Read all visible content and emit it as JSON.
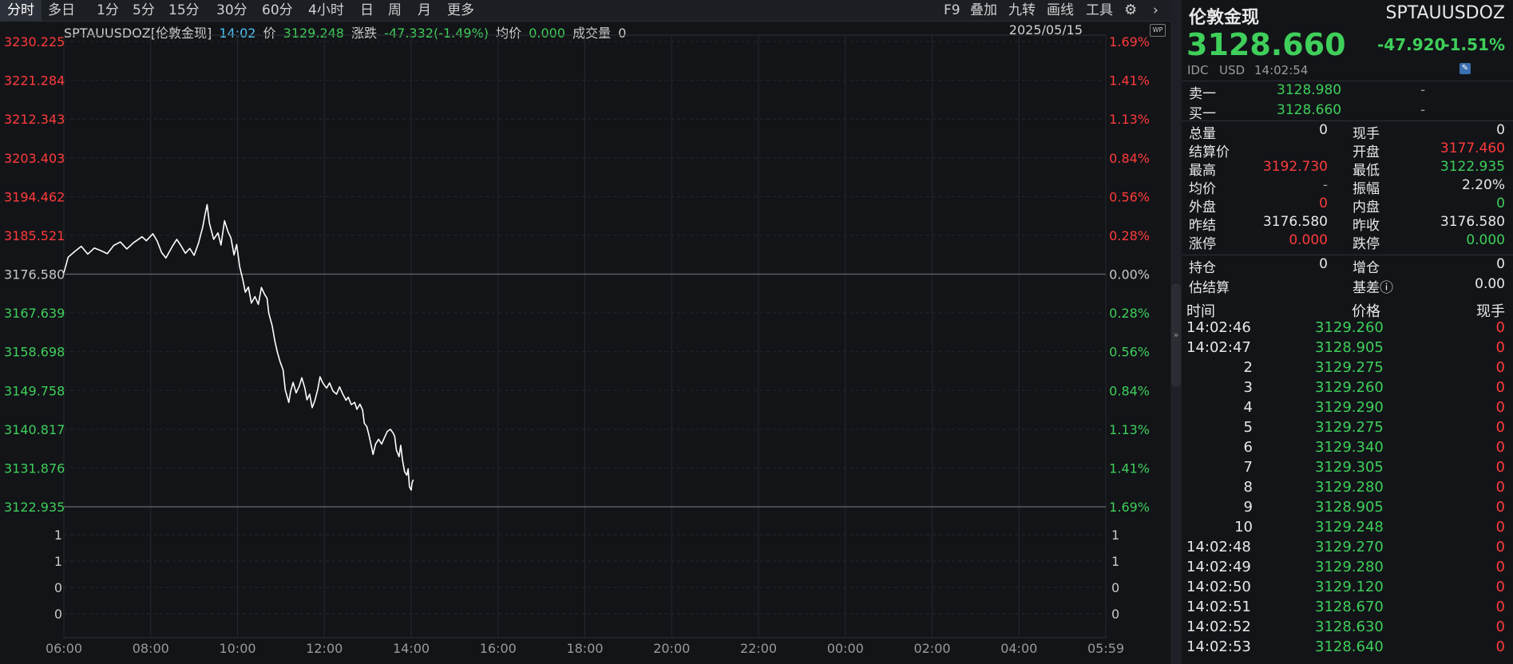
{
  "toolbar": {
    "tabs": [
      "分时",
      "多日",
      "1分",
      "5分",
      "15分",
      "30分",
      "60分",
      "4小时",
      "日",
      "周",
      "月",
      "更多"
    ],
    "active_tab": "分时",
    "right_items": [
      "F9",
      "叠加",
      "九转",
      "画线",
      "工具"
    ],
    "gear_icon": "gear-icon",
    "more_icon": "chevron-right-icon"
  },
  "info": {
    "symbol": "SPTAUUSDOZ[伦敦金现]",
    "time": "14:02",
    "price_label": "价",
    "price": "3129.248",
    "change_label": "涨跌",
    "change": "-47.332(-1.49%)",
    "avg_label": "均价",
    "avg": "0.000",
    "volume_label": "成交量",
    "volume": "0",
    "date": "2025/05/15",
    "badge": "WP"
  },
  "chart_data": {
    "type": "line",
    "title": "",
    "price_axis": {
      "ticks": [
        "3230.225",
        "3221.284",
        "3212.343",
        "3203.403",
        "3194.462",
        "3185.521",
        "3176.580",
        "3167.639",
        "3158.698",
        "3149.758",
        "3140.817",
        "3131.876",
        "3122.935"
      ],
      "pct_ticks": [
        "1.69%",
        "1.41%",
        "1.13%",
        "0.84%",
        "0.56%",
        "0.28%",
        "0.00%",
        "0.28%",
        "0.56%",
        "0.84%",
        "1.13%",
        "1.41%",
        "1.69%"
      ],
      "ylim": [
        3122.935,
        3230.225
      ],
      "baseline": 3176.58
    },
    "volume_axis": {
      "ticks": [
        "1",
        "1",
        "0",
        "0"
      ]
    },
    "x_ticks": [
      "06:00",
      "08:00",
      "10:00",
      "12:00",
      "14:00",
      "16:00",
      "18:00",
      "20:00",
      "22:00",
      "00:00",
      "02:00",
      "04:00",
      "05:59"
    ],
    "x_unit": "hours_since_06:00",
    "x_range": [
      0,
      24
    ],
    "series": [
      {
        "color": "#ffffff",
        "points": [
          [
            0.0,
            3176.9
          ],
          [
            0.1,
            3180.5
          ],
          [
            0.25,
            3181.8
          ],
          [
            0.4,
            3183.0
          ],
          [
            0.55,
            3181.2
          ],
          [
            0.7,
            3182.6
          ],
          [
            0.85,
            3182.0
          ],
          [
            1.0,
            3181.3
          ],
          [
            1.15,
            3183.2
          ],
          [
            1.3,
            3184.0
          ],
          [
            1.45,
            3182.4
          ],
          [
            1.6,
            3183.8
          ],
          [
            1.8,
            3185.2
          ],
          [
            1.9,
            3184.3
          ],
          [
            2.05,
            3185.9
          ],
          [
            2.15,
            3184.2
          ],
          [
            2.25,
            3181.6
          ],
          [
            2.35,
            3180.3
          ],
          [
            2.5,
            3183.0
          ],
          [
            2.6,
            3184.6
          ],
          [
            2.7,
            3183.1
          ],
          [
            2.8,
            3181.4
          ],
          [
            2.9,
            3182.5
          ],
          [
            3.0,
            3180.9
          ],
          [
            3.1,
            3183.7
          ],
          [
            3.2,
            3187.5
          ],
          [
            3.25,
            3190.2
          ],
          [
            3.3,
            3192.6
          ],
          [
            3.35,
            3188.4
          ],
          [
            3.45,
            3184.6
          ],
          [
            3.55,
            3186.1
          ],
          [
            3.62,
            3183.3
          ],
          [
            3.7,
            3188.9
          ],
          [
            3.78,
            3186.4
          ],
          [
            3.85,
            3184.9
          ],
          [
            3.92,
            3181.0
          ],
          [
            3.98,
            3183.4
          ],
          [
            4.05,
            3178.3
          ],
          [
            4.12,
            3175.4
          ],
          [
            4.18,
            3172.4
          ],
          [
            4.25,
            3173.6
          ],
          [
            4.32,
            3169.9
          ],
          [
            4.4,
            3171.4
          ],
          [
            4.48,
            3169.6
          ],
          [
            4.55,
            3173.5
          ],
          [
            4.62,
            3172.0
          ],
          [
            4.68,
            3171.0
          ],
          [
            4.72,
            3167.6
          ],
          [
            4.8,
            3164.6
          ],
          [
            4.86,
            3161.1
          ],
          [
            4.92,
            3158.5
          ],
          [
            4.98,
            3156.4
          ],
          [
            5.05,
            3154.5
          ],
          [
            5.1,
            3149.9
          ],
          [
            5.18,
            3147.0
          ],
          [
            5.22,
            3149.4
          ],
          [
            5.28,
            3151.6
          ],
          [
            5.35,
            3149.2
          ],
          [
            5.42,
            3150.7
          ],
          [
            5.48,
            3152.7
          ],
          [
            5.55,
            3150.3
          ],
          [
            5.6,
            3147.6
          ],
          [
            5.66,
            3148.9
          ],
          [
            5.72,
            3145.8
          ],
          [
            5.78,
            3147.4
          ],
          [
            5.85,
            3150.1
          ],
          [
            5.9,
            3152.9
          ],
          [
            5.97,
            3151.4
          ],
          [
            6.05,
            3150.3
          ],
          [
            6.12,
            3151.5
          ],
          [
            6.2,
            3149.6
          ],
          [
            6.28,
            3148.9
          ],
          [
            6.35,
            3150.6
          ],
          [
            6.42,
            3149.0
          ],
          [
            6.5,
            3147.5
          ],
          [
            6.55,
            3148.2
          ],
          [
            6.62,
            3146.5
          ],
          [
            6.7,
            3147.0
          ],
          [
            6.75,
            3145.4
          ],
          [
            6.82,
            3146.6
          ],
          [
            6.88,
            3145.3
          ],
          [
            6.92,
            3142.2
          ],
          [
            6.98,
            3141.4
          ],
          [
            7.03,
            3139.3
          ],
          [
            7.08,
            3137.0
          ],
          [
            7.12,
            3135.0
          ],
          [
            7.18,
            3137.4
          ],
          [
            7.25,
            3138.5
          ],
          [
            7.32,
            3137.4
          ],
          [
            7.38,
            3138.8
          ],
          [
            7.45,
            3140.3
          ],
          [
            7.52,
            3140.8
          ],
          [
            7.58,
            3140.0
          ],
          [
            7.62,
            3139.2
          ],
          [
            7.66,
            3136.0
          ],
          [
            7.72,
            3134.5
          ],
          [
            7.76,
            3137.1
          ],
          [
            7.8,
            3133.7
          ],
          [
            7.85,
            3131.0
          ],
          [
            7.9,
            3130.2
          ],
          [
            7.93,
            3131.7
          ],
          [
            7.96,
            3127.6
          ],
          [
            8.0,
            3126.8
          ],
          [
            8.02,
            3128.5
          ],
          [
            8.05,
            3129.2
          ]
        ]
      }
    ]
  },
  "right": {
    "name": "伦敦金现",
    "code": "SPTAUUSDOZ",
    "price": "3128.660",
    "change": "-47.920",
    "change_pct": "-1.51%",
    "source": "IDC",
    "currency": "USD",
    "time": "14:02:54",
    "edit_icon": "pencil-icon",
    "ask_label": "卖一",
    "ask": "3128.980",
    "ask_vol": "-",
    "bid_label": "买一",
    "bid": "3128.660",
    "bid_vol": "-",
    "stats": [
      {
        "l1": "总量",
        "v1": "0",
        "c1": "white",
        "l2": "现手",
        "v2": "0",
        "c2": "white"
      },
      {
        "l1": "结算价",
        "v1": "",
        "c1": "white",
        "l2": "开盘",
        "v2": "3177.460",
        "c2": "red"
      },
      {
        "l1": "最高",
        "v1": "3192.730",
        "c1": "red",
        "l2": "最低",
        "v2": "3122.935",
        "c2": "green"
      },
      {
        "l1": "均价",
        "v1": "-",
        "c1": "grey",
        "l2": "振幅",
        "v2": "2.20%",
        "c2": "white"
      },
      {
        "l1": "外盘",
        "v1": "0",
        "c1": "red",
        "l2": "内盘",
        "v2": "0",
        "c2": "green"
      },
      {
        "l1": "昨结",
        "v1": "3176.580",
        "c1": "white",
        "l2": "昨收",
        "v2": "3176.580",
        "c2": "white"
      },
      {
        "l1": "涨停",
        "v1": "0.000",
        "c1": "red",
        "l2": "跌停",
        "v2": "0.000",
        "c2": "green"
      }
    ],
    "pos_label": "持仓",
    "pos": "0",
    "inc_label": "增仓",
    "inc": "0",
    "est_label": "估结算",
    "basis_label": "基差ⓘ",
    "basis": "0.00",
    "ticks_header": {
      "time": "时间",
      "price": "价格",
      "vol": "现手"
    },
    "ticks": [
      {
        "t": "14:02:46",
        "p": "3129.260",
        "v": "0",
        "indent": false
      },
      {
        "t": "14:02:47",
        "p": "3128.905",
        "v": "0",
        "indent": false
      },
      {
        "t": "2",
        "p": "3129.275",
        "v": "0",
        "indent": true
      },
      {
        "t": "3",
        "p": "3129.260",
        "v": "0",
        "indent": true
      },
      {
        "t": "4",
        "p": "3129.290",
        "v": "0",
        "indent": true
      },
      {
        "t": "5",
        "p": "3129.275",
        "v": "0",
        "indent": true
      },
      {
        "t": "6",
        "p": "3129.340",
        "v": "0",
        "indent": true
      },
      {
        "t": "7",
        "p": "3129.305",
        "v": "0",
        "indent": true
      },
      {
        "t": "8",
        "p": "3129.280",
        "v": "0",
        "indent": true
      },
      {
        "t": "9",
        "p": "3128.905",
        "v": "0",
        "indent": true
      },
      {
        "t": "10",
        "p": "3129.248",
        "v": "0",
        "indent": true
      },
      {
        "t": "14:02:48",
        "p": "3129.270",
        "v": "0",
        "indent": false
      },
      {
        "t": "14:02:49",
        "p": "3129.280",
        "v": "0",
        "indent": false
      },
      {
        "t": "14:02:50",
        "p": "3129.120",
        "v": "0",
        "indent": false
      },
      {
        "t": "14:02:51",
        "p": "3128.670",
        "v": "0",
        "indent": false
      },
      {
        "t": "14:02:52",
        "p": "3128.630",
        "v": "0",
        "indent": false
      },
      {
        "t": "14:02:53",
        "p": "3128.640",
        "v": "0",
        "indent": false
      }
    ]
  },
  "colors": {
    "up": "#ff3b3b",
    "down": "#3fcf5a",
    "line": "#ffffff",
    "grid": "#3a3d44",
    "bg": "#121418"
  }
}
